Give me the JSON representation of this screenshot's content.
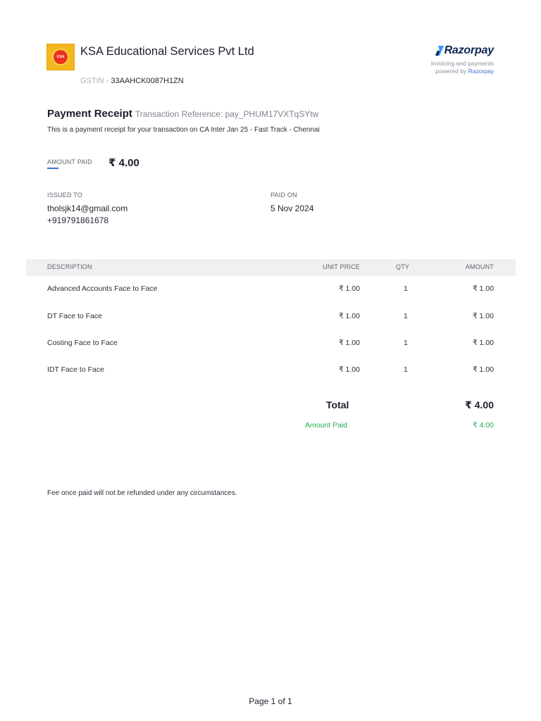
{
  "merchant": {
    "name": "KSA Educational Services Pvt Ltd",
    "gstin_label": "GSTIN - ",
    "gstin": "33AAHCK0087H1ZN",
    "logo_text": "KSA"
  },
  "provider": {
    "name": "Razorpay",
    "tagline_1": "Invoicing and payments",
    "tagline_2": "powered by ",
    "tagline_link": "Razorpay",
    "colors": {
      "mark": "#3395ff",
      "text": "#0c2451"
    }
  },
  "receipt": {
    "title": "Payment Receipt",
    "reference": "Transaction Reference: pay_PHUM17VXTqSYtw",
    "description": "This is a payment receipt for your transaction on CA Inter Jan 25 - Fast Track - Chennai"
  },
  "amount_paid": {
    "label": "AMOUNT PAID",
    "value": "₹ 4.00"
  },
  "issued_to": {
    "label": "ISSUED TO",
    "email": "tholsjk14@gmail.com",
    "phone": "+919791861678"
  },
  "paid_on": {
    "label": "PAID ON",
    "date": "5 Nov 2024"
  },
  "table": {
    "headers": {
      "description": "DESCRIPTION",
      "unit_price": "UNIT PRICE",
      "qty": "QTY",
      "amount": "AMOUNT"
    },
    "rows": [
      {
        "description": "Advanced Accounts Face to Face",
        "unit_price": "₹ 1.00",
        "qty": "1",
        "amount": "₹ 1.00"
      },
      {
        "description": "DT Face to Face",
        "unit_price": "₹ 1.00",
        "qty": "1",
        "amount": "₹ 1.00"
      },
      {
        "description": "Costing Face to Face",
        "unit_price": "₹ 1.00",
        "qty": "1",
        "amount": "₹ 1.00"
      },
      {
        "description": "IDT Face to Face",
        "unit_price": "₹ 1.00",
        "qty": "1",
        "amount": "₹ 1.00"
      }
    ]
  },
  "totals": {
    "total_label": "Total",
    "total_value": "₹ 4.00",
    "amount_paid_label": "Amount Paid",
    "amount_paid_value": "₹ 4.00",
    "paid_color": "#22b14c"
  },
  "note": "Fee once paid will not be refunded under any circumstances.",
  "footer": {
    "page": "Page 1 of 1"
  }
}
